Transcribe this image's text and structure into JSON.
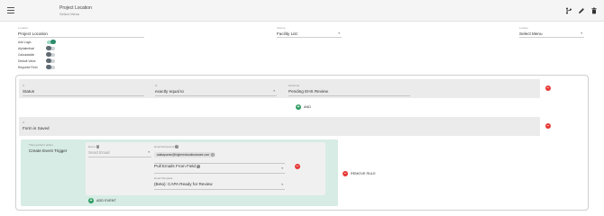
{
  "header": {
    "title": "Project Location",
    "subtitle": "Select Menu",
    "icons": [
      "menu-icon",
      "branch-icon",
      "edit-icon",
      "delete-icon"
    ]
  },
  "form": {
    "location": {
      "label": "Location",
      "value": "Project Location"
    },
    "source": {
      "label": "Source",
      "value": "Facility List"
    },
    "lookup": {
      "label": "Lookup",
      "value": "Select Menu"
    }
  },
  "toggles": [
    {
      "label": "Add Logic",
      "on": true
    },
    {
      "label": "Alphabetical",
      "on": false
    },
    {
      "label": "Calculatable",
      "on": false
    },
    {
      "label": "Default Value",
      "on": false
    },
    {
      "label": "Required Field",
      "on": false
    }
  ],
  "rules": {
    "condition1": {
      "field": {
        "label": "If",
        "value": "Status"
      },
      "operator": {
        "label": "Is",
        "value": "exactly equal to"
      },
      "value": {
        "label": "Outcome",
        "value": "Pending EHS Review"
      }
    },
    "and_label": "AND",
    "condition2": {
      "field": {
        "label": "If",
        "value": "Form is Saved"
      }
    },
    "event": {
      "label": "Then perform action",
      "value": "Create Event Trigger",
      "event_label": "Event",
      "event_value": "Send Email",
      "recipient_label": "Email Recipients",
      "recipient_email": "adatapuram@highereducationsware.com",
      "pull_label": "Pull Emails From Field",
      "template_label": "Email Template",
      "template_value": "(Beta): CAPA Ready for Review",
      "add_event_label": "ADD EVENT"
    },
    "remove_rule_label": "REMOVE RULE"
  },
  "colors": {
    "accent_green": "#2e9b62",
    "remove_red": "#e53935",
    "event_bg": "#d6ece4"
  }
}
